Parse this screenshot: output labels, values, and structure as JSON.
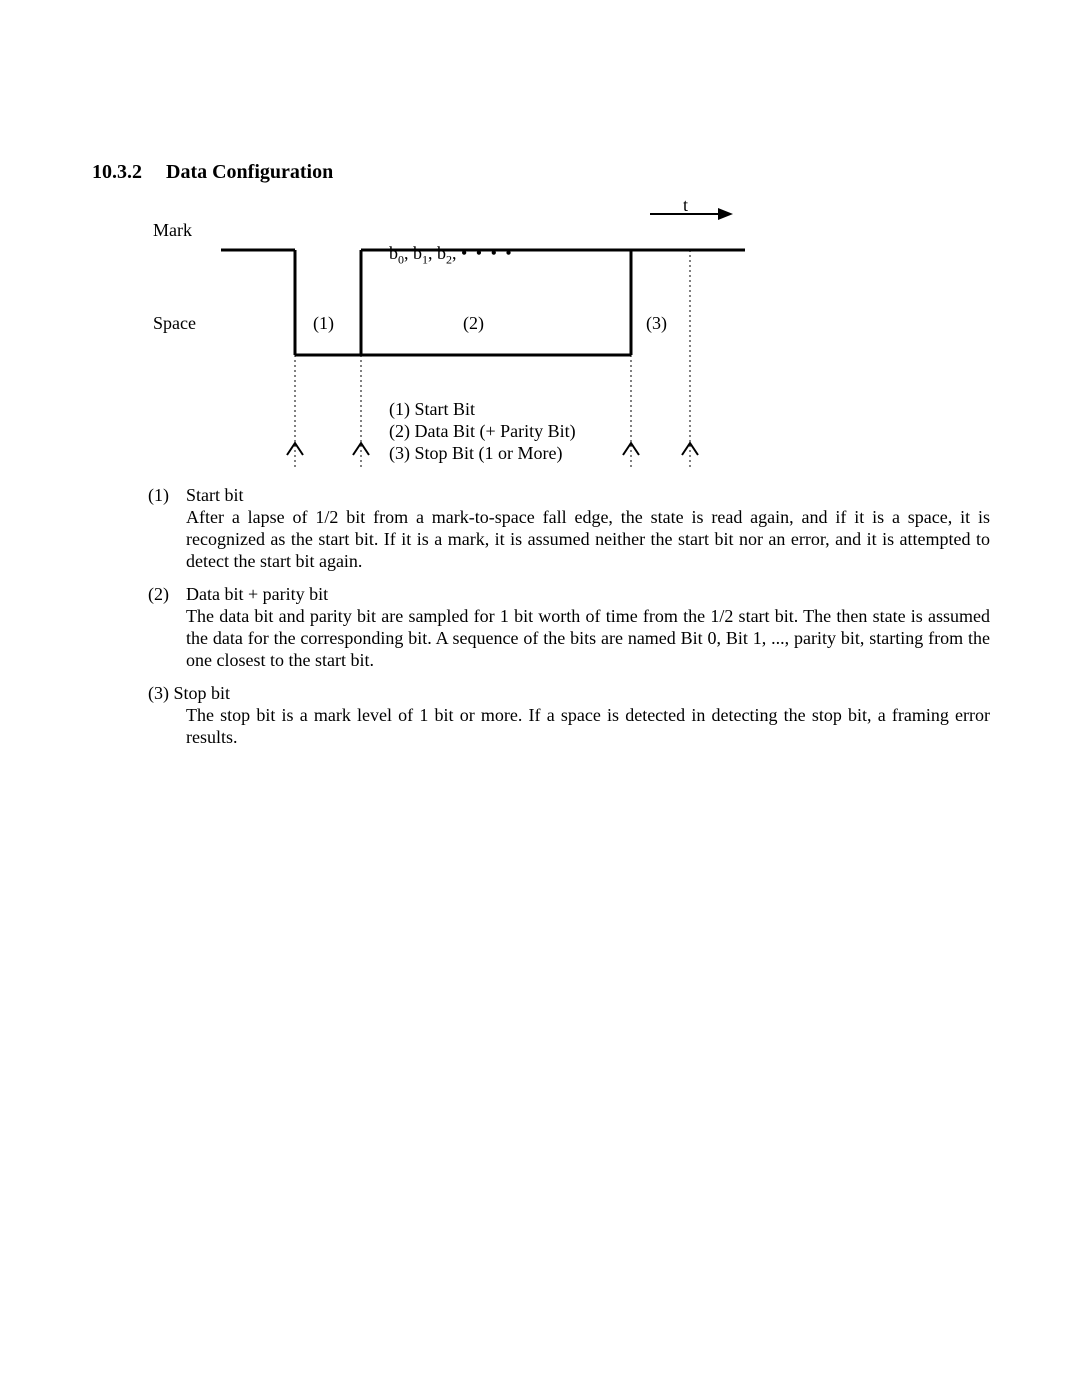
{
  "heading": {
    "number": "10.3.2",
    "title": "Data Configuration"
  },
  "diagram": {
    "mark_label": "Mark",
    "space_label": "Space",
    "t_label": "t",
    "bits_html": "b<span class=\"sub\">0</span>, b<span class=\"sub\">1</span>, b<span class=\"sub\">2</span>, <span class=\"dots\">• • • •</span>",
    "region_1": "(1)",
    "region_2": "(2)",
    "region_3": "(3)",
    "legend": {
      "l1": "(1) Start Bit",
      "l2": "(2) Data Bit (+ Parity Bit)",
      "l3": "(3) Stop Bit (1 or More)"
    }
  },
  "sections": {
    "s1": {
      "num": "(1)",
      "title": "Start bit",
      "body": "After a lapse of 1/2 bit from a mark-to-space fall edge, the state is read again, and if it is a space, it is recognized as the start bit.  If it is a mark, it is assumed neither the start bit nor an error, and it is attempted to detect the start bit again."
    },
    "s2": {
      "num": "(2)",
      "title": "Data bit + parity bit",
      "body": "The data bit and parity bit are sampled for 1 bit worth of time from the 1/2 start bit.  The then state is assumed the data for the corresponding bit.  A sequence of the bits are named Bit 0, Bit 1, ..., parity bit, starting from the one closest to the start bit."
    },
    "s3": {
      "num": "(3)",
      "head": "(3) Stop bit",
      "body": "The stop bit is a mark level of 1 bit or more.  If a space is detected in detecting the stop bit, a framing error results."
    }
  }
}
